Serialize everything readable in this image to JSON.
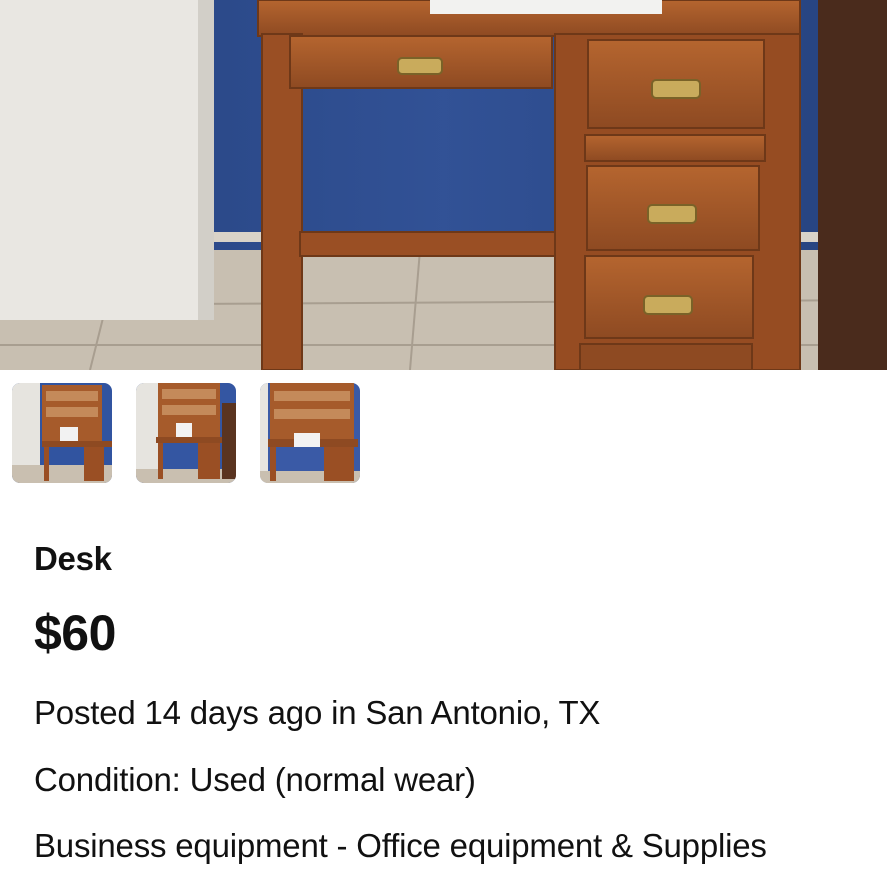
{
  "listing": {
    "hero_image": "desk-photo",
    "thumbnails": [
      {
        "name": "desk-hutch-photo-1"
      },
      {
        "name": "desk-hutch-photo-2"
      },
      {
        "name": "desk-hutch-photo-3"
      }
    ],
    "title": "Desk",
    "price": "$60",
    "posted": "Posted 14 days ago in San Antonio, TX",
    "condition": "Condition: Used (normal wear)",
    "category": "Business equipment - Office equipment & Supplies"
  },
  "colors": {
    "wall": "#2b4a8c",
    "wood": "#a0522d",
    "floor": "#c9bfb0",
    "door": "#e8e6e1"
  }
}
